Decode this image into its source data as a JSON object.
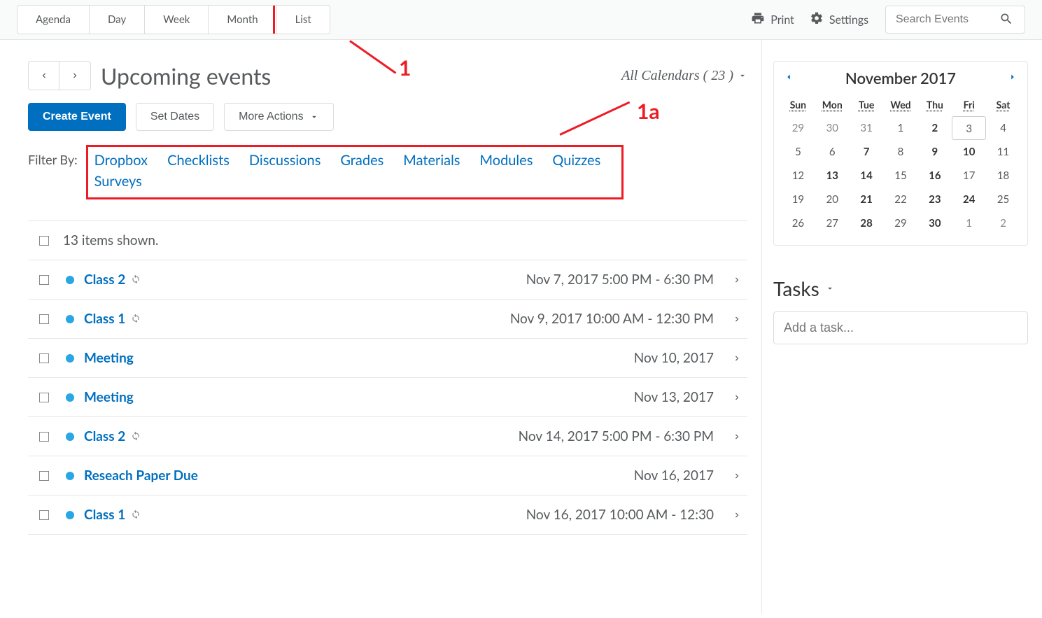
{
  "topbar": {
    "tabs": [
      "Agenda",
      "Day",
      "Week",
      "Month",
      "List"
    ],
    "active_tab_index": 4,
    "print_label": "Print",
    "settings_label": "Settings",
    "search_placeholder": "Search Events"
  },
  "annotations": {
    "tab_label": "1",
    "filter_label": "1a"
  },
  "header": {
    "title": "Upcoming events",
    "all_calendars_label": "All Calendars ( 23 )"
  },
  "buttons": {
    "create_event": "Create Event",
    "set_dates": "Set Dates",
    "more_actions": "More Actions"
  },
  "filter": {
    "label": "Filter By:",
    "items": [
      "Dropbox",
      "Checklists",
      "Discussions",
      "Grades",
      "Materials",
      "Modules",
      "Quizzes",
      "Surveys"
    ]
  },
  "events": {
    "summary": "13 items shown.",
    "list": [
      {
        "title": "Class 2",
        "recurring": true,
        "date": "Nov 7, 2017 5:00 PM - 6:30 PM"
      },
      {
        "title": "Class 1",
        "recurring": true,
        "date": "Nov 9, 2017 10:00 AM - 12:30 PM"
      },
      {
        "title": "Meeting",
        "recurring": false,
        "date": "Nov 10, 2017"
      },
      {
        "title": "Meeting",
        "recurring": false,
        "date": "Nov 13, 2017"
      },
      {
        "title": "Class 2",
        "recurring": true,
        "date": "Nov 14, 2017 5:00 PM - 6:30 PM"
      },
      {
        "title": "Reseach Paper Due",
        "recurring": false,
        "date": "Nov 16, 2017"
      },
      {
        "title": "Class 1",
        "recurring": true,
        "date": "Nov 16, 2017 10:00 AM - 12:30"
      }
    ]
  },
  "mini_calendar": {
    "title": "November 2017",
    "day_headers": [
      "Sun",
      "Mon",
      "Tue",
      "Wed",
      "Thu",
      "Fri",
      "Sat"
    ],
    "weeks": [
      [
        {
          "d": "29",
          "in": false
        },
        {
          "d": "30",
          "in": false
        },
        {
          "d": "31",
          "in": false
        },
        {
          "d": "1",
          "in": true
        },
        {
          "d": "2",
          "in": true,
          "bold": true
        },
        {
          "d": "3",
          "in": true,
          "today": true
        },
        {
          "d": "4",
          "in": true
        }
      ],
      [
        {
          "d": "5",
          "in": true
        },
        {
          "d": "6",
          "in": true
        },
        {
          "d": "7",
          "in": true,
          "bold": true
        },
        {
          "d": "8",
          "in": true
        },
        {
          "d": "9",
          "in": true,
          "bold": true
        },
        {
          "d": "10",
          "in": true,
          "bold": true
        },
        {
          "d": "11",
          "in": true
        }
      ],
      [
        {
          "d": "12",
          "in": true
        },
        {
          "d": "13",
          "in": true,
          "bold": true
        },
        {
          "d": "14",
          "in": true,
          "bold": true
        },
        {
          "d": "15",
          "in": true
        },
        {
          "d": "16",
          "in": true,
          "bold": true
        },
        {
          "d": "17",
          "in": true
        },
        {
          "d": "18",
          "in": true
        }
      ],
      [
        {
          "d": "19",
          "in": true
        },
        {
          "d": "20",
          "in": true
        },
        {
          "d": "21",
          "in": true,
          "bold": true
        },
        {
          "d": "22",
          "in": true
        },
        {
          "d": "23",
          "in": true,
          "bold": true
        },
        {
          "d": "24",
          "in": true,
          "bold": true
        },
        {
          "d": "25",
          "in": true
        }
      ],
      [
        {
          "d": "26",
          "in": true
        },
        {
          "d": "27",
          "in": true
        },
        {
          "d": "28",
          "in": true,
          "bold": true
        },
        {
          "d": "29",
          "in": true
        },
        {
          "d": "30",
          "in": true,
          "bold": true
        },
        {
          "d": "1",
          "in": false
        },
        {
          "d": "2",
          "in": false
        }
      ]
    ]
  },
  "tasks": {
    "header": "Tasks",
    "placeholder": "Add a task..."
  }
}
